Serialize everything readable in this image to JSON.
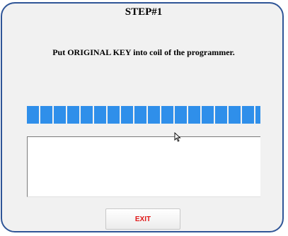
{
  "dialog": {
    "title": "STEP#1",
    "instruction": "Put ORIGINAL  KEY into coil of the programmer."
  },
  "progress": {
    "value_fraction": 1.0,
    "color": "#2f8fea"
  },
  "log": {
    "text": ""
  },
  "buttons": {
    "exit_label": "EXIT"
  },
  "colors": {
    "frame_border": "#2f5597",
    "background": "#f1f1f1",
    "exit_text": "#e01818"
  }
}
